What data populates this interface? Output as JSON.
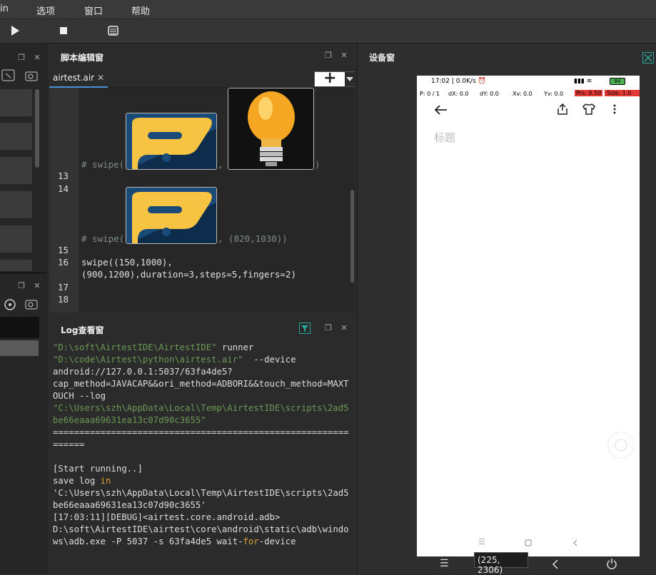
{
  "menubar": {
    "items": [
      "in",
      "选项",
      "窗口",
      "帮助"
    ]
  },
  "editor": {
    "title": "脚本编辑窗",
    "tab_label": "airtest.air",
    "tab_close": "✕",
    "add_label": "+",
    "lines": {
      "l13_num": "13",
      "l14_num": "14",
      "l15_num": "15",
      "l16_num": "16",
      "l17_num": "17",
      "l18_num": "18",
      "swipe1_prefix": "# swipe(",
      "swipe1_mid": ", ",
      "swipe1_suffix": ")",
      "swipe2_prefix": "# swipe(",
      "swipe2_suffix": ", (820,1030))",
      "l16a": "swipe((150,1000),",
      "l16b": "(900,1200),duration=3,steps=5,fingers=2)"
    }
  },
  "log": {
    "title": "Log查看窗",
    "line1_str": "\"D:\\soft\\AirtestIDE\\AirtestIDE\"",
    "line1_rest": " runner",
    "line2_str": "\"D:\\code\\Airtest\\python\\airtest.air\"",
    "line2_rest": "  --device",
    "line3": "android://127.0.0.1:5037/63fa4de5?",
    "line4": "cap_method=JAVACAP&&ori_method=ADBORI&&touch_method=MAXTOUCH --log",
    "line5_str": "\"C:\\Users\\szh\\AppData\\Local\\Temp\\AirtestIDE\\scripts\\2ad5be66eaaa69631ea13c07d90c3655\"",
    "separator": "==============================================================",
    "start": "[Start running..]",
    "save_log": "save log ",
    "save_in": "in",
    "path_quote": "'C:\\Users\\szh\\AppData\\Local\\Temp\\AirtestIDE\\scripts\\2ad5be66eaaa69631ea13c07d90c3655'",
    "debug": "[17:03:11][DEBUG]<airtest.core.android.adb>",
    "adb_cmd": "D:\\soft\\AirtestIDE\\airtest\\core\\android\\static\\adb\\windows\\adb.exe -P 5037 -s 63fa4de5 wait-",
    "adb_for": "for",
    "adb_end": "-device"
  },
  "device": {
    "title": "设备窗",
    "status": {
      "time": "17:02 | 0.0K/s ⏰",
      "battery": "84",
      "p": "P: 0 / 1",
      "dx": "dX: 0.0",
      "dy": "dY: 0.0",
      "xv": "Xv: 0.0",
      "yv": "Yv: 0.0",
      "prs": "Prs: 0.50",
      "size": "Size: 1.0"
    },
    "page_title": "标题",
    "coord_tip": "(225, 2306)"
  },
  "colors": {
    "accent": "#4a90d9",
    "pressure_bg": "#e53935"
  }
}
